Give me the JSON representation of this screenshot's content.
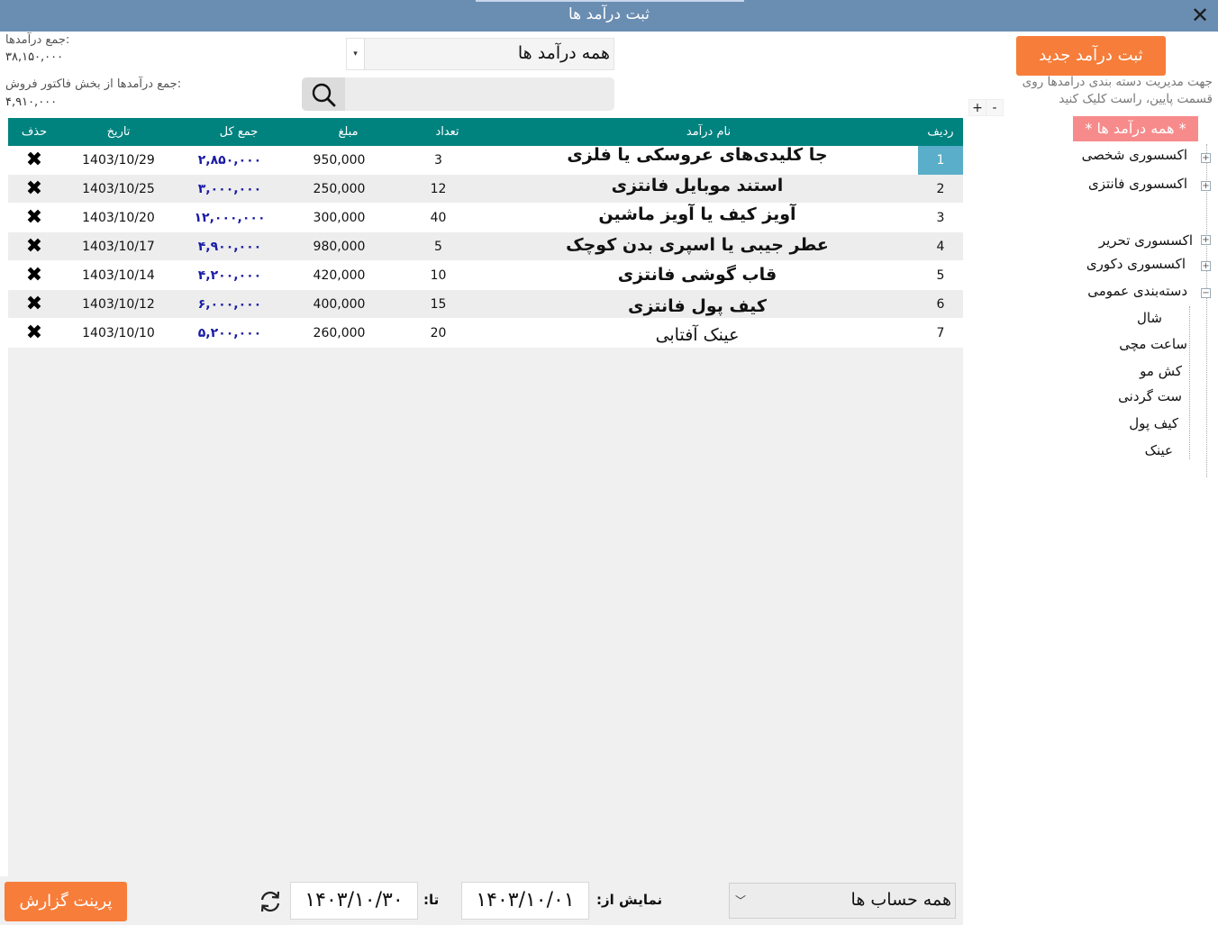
{
  "window": {
    "title": "ثبت درآمد ها",
    "close_label": "✕"
  },
  "summary": {
    "total_label": "جمع درآمدها:",
    "total_value": "۳۸,۱۵۰,۰۰۰",
    "invoice_label": "جمع درآمدها از بخش فاکتور فروش:",
    "invoice_value": "۴,۹۱۰,۰۰۰"
  },
  "filter": {
    "category_value": "همه درآمد ها",
    "search_value": ""
  },
  "actions": {
    "new_label": "ثبت درآمد جدید",
    "hint": "جهت مدیریت دسته بندی درامدها روی قسمت پایین، راست کلیک کنید",
    "expand_label": "+",
    "collapse_label": "-"
  },
  "table": {
    "headers": {
      "del": "حذف",
      "date": "تاریخ",
      "total": "جمع کل",
      "amount": "مبلغ",
      "qty": "تعداد",
      "name": "نام درآمد",
      "idx": "ردیف"
    },
    "delete_icon": "x-delete-icon",
    "rows": [
      {
        "idx": "1",
        "name": "جا کلیدی‌های عروسکی یا فلزی",
        "qty": "3",
        "amount": "950,000",
        "total": "۲,۸۵۰,۰۰۰",
        "date": "1403/10/29",
        "del": "✖"
      },
      {
        "idx": "2",
        "name": "استند موبایل فانتزی",
        "qty": "12",
        "amount": "250,000",
        "total": "۳,۰۰۰,۰۰۰",
        "date": "1403/10/25",
        "del": "✖"
      },
      {
        "idx": "3",
        "name": "آویز کیف یا آویز ماشین",
        "qty": "40",
        "amount": "300,000",
        "total": "۱۲,۰۰۰,۰۰۰",
        "date": "1403/10/20",
        "del": "✖"
      },
      {
        "idx": "4",
        "name": "عطر جیبی یا اسپری بدن کوچک",
        "qty": "5",
        "amount": "980,000",
        "total": "۴,۹۰۰,۰۰۰",
        "date": "1403/10/17",
        "del": "✖"
      },
      {
        "idx": "5",
        "name": "قاب گوشی فانتزی",
        "qty": "10",
        "amount": "420,000",
        "total": "۴,۲۰۰,۰۰۰",
        "date": "1403/10/14",
        "del": "✖"
      },
      {
        "idx": "6",
        "name": "کیف پول فانتزی",
        "qty": "15",
        "amount": "400,000",
        "total": "۶,۰۰۰,۰۰۰",
        "date": "1403/10/12",
        "del": "✖"
      },
      {
        "idx": "7",
        "name": "عینک آفتابی",
        "qty": "20",
        "amount": "260,000",
        "total": "۵,۲۰۰,۰۰۰",
        "date": "1403/10/10",
        "del": "✖"
      }
    ]
  },
  "tree": {
    "all_label": "* همه درآمد ها *",
    "groups": [
      "اکسسوری شخصی",
      "اکسسوری فانتزی",
      "اکسسوری تحریر",
      "اکسسوری دکوری",
      "دسته‌بندی عمومی"
    ],
    "children": [
      "شال",
      "ساعت مچی",
      "کش مو",
      "ست گردنی",
      "کیف پول",
      "عینک"
    ]
  },
  "footer": {
    "print_label": "پرینت گزارش",
    "to_label": "تا:",
    "to_value": "۱۴۰۳/۱۰/۳۰",
    "from_label": "نمایش از:",
    "from_value": "۱۴۰۳/۱۰/۰۱",
    "account_value": "همه حساب ها",
    "chevron": "﹀"
  }
}
